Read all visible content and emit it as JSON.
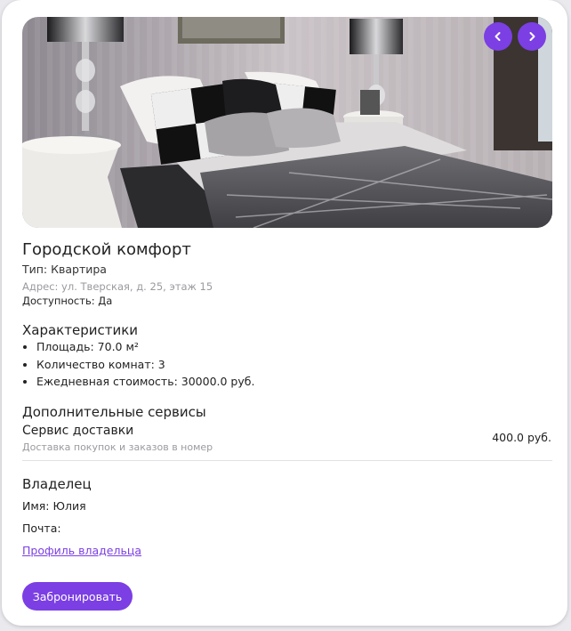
{
  "listing": {
    "title": "Городской комфорт",
    "type": "Тип: Квартира",
    "address": "Адрес: ул. Тверская, д. 25, этаж 15",
    "availability": "Доступность: Да"
  },
  "photo": {
    "alt": "Фотография спальни"
  },
  "characteristics": {
    "heading": "Характеристики",
    "items": [
      "Площадь: 70.0 м²",
      "Количество комнат: 3",
      "Ежедневная стоимость: 30000.0 руб."
    ]
  },
  "services": {
    "heading": "Дополнительные сервисы",
    "items": [
      {
        "name": "Сервис доставки",
        "description": "Доставка покупок и заказов в номер",
        "price": "400.0 руб."
      }
    ]
  },
  "owner": {
    "heading": "Владелец",
    "name": "Имя: Юлия",
    "email": "Почта:",
    "profile_link": "Профиль владельца"
  },
  "actions": {
    "book_label": "Забронировать"
  },
  "colors": {
    "accent": "#7b3fe4",
    "muted_text": "#9a9aa0"
  },
  "icons": {
    "prev": "chevron-left-icon",
    "next": "chevron-right-icon"
  }
}
